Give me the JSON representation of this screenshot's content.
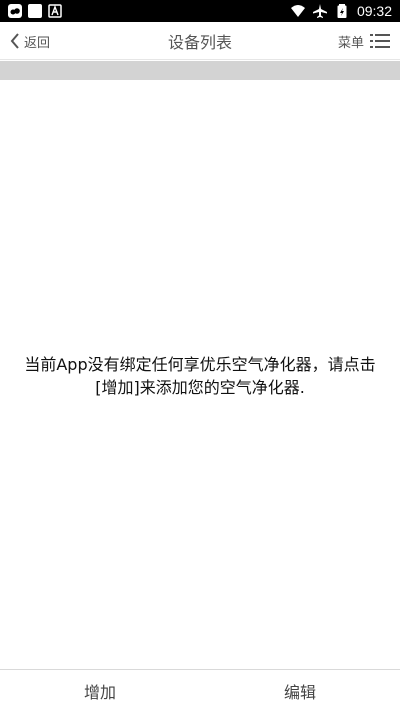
{
  "status_bar": {
    "time": "09:32",
    "icons": [
      "cloud-app-icon",
      "square-app-icon",
      "a-app-icon",
      "wifi-icon",
      "airplane-icon",
      "battery-icon"
    ]
  },
  "header": {
    "back_label": "返回",
    "title": "设备列表",
    "menu_label": "菜单"
  },
  "main": {
    "empty_message_line1": "当前App没有绑定任何享优乐空气净化器，请点击",
    "empty_message_line2": "[增加]来添加您的空气净化器."
  },
  "bottom_bar": {
    "add_label": "增加",
    "edit_label": "编辑"
  },
  "colors": {
    "status_bar_bg": "#000000",
    "band": "#d3d3d3",
    "text": "#555555"
  }
}
